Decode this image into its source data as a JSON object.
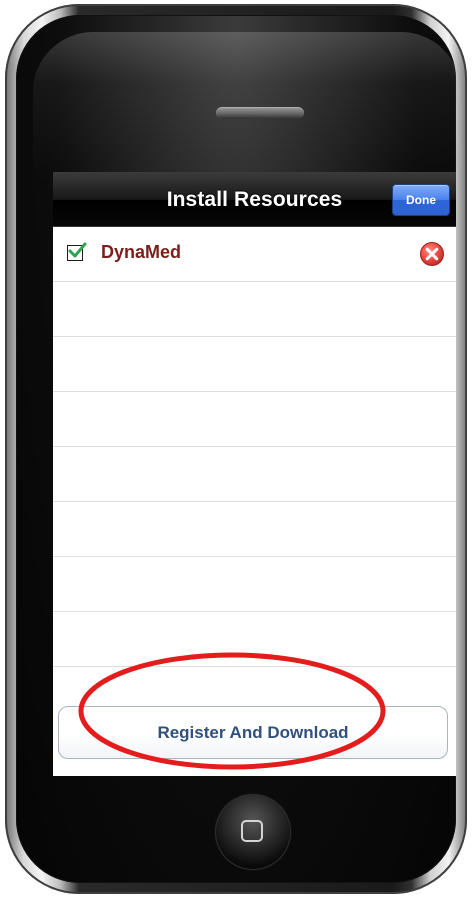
{
  "navbar": {
    "title": "Install Resources",
    "done_label": "Done"
  },
  "resources": [
    {
      "name": "DynaMed",
      "checked": true
    }
  ],
  "actions": {
    "register_download_label": "Register And Download"
  },
  "colors": {
    "navbar_dark": "#000000",
    "done_blue": "#3B73E2",
    "resource_label": "#7B1F1B",
    "remove_red": "#D9534F",
    "annotation_red": "#E51C1C",
    "button_text": "#31507C"
  },
  "icons": {
    "checkbox": "green-check-checkbox-icon",
    "remove": "remove-circle-x-icon",
    "home": "home-button-icon"
  }
}
